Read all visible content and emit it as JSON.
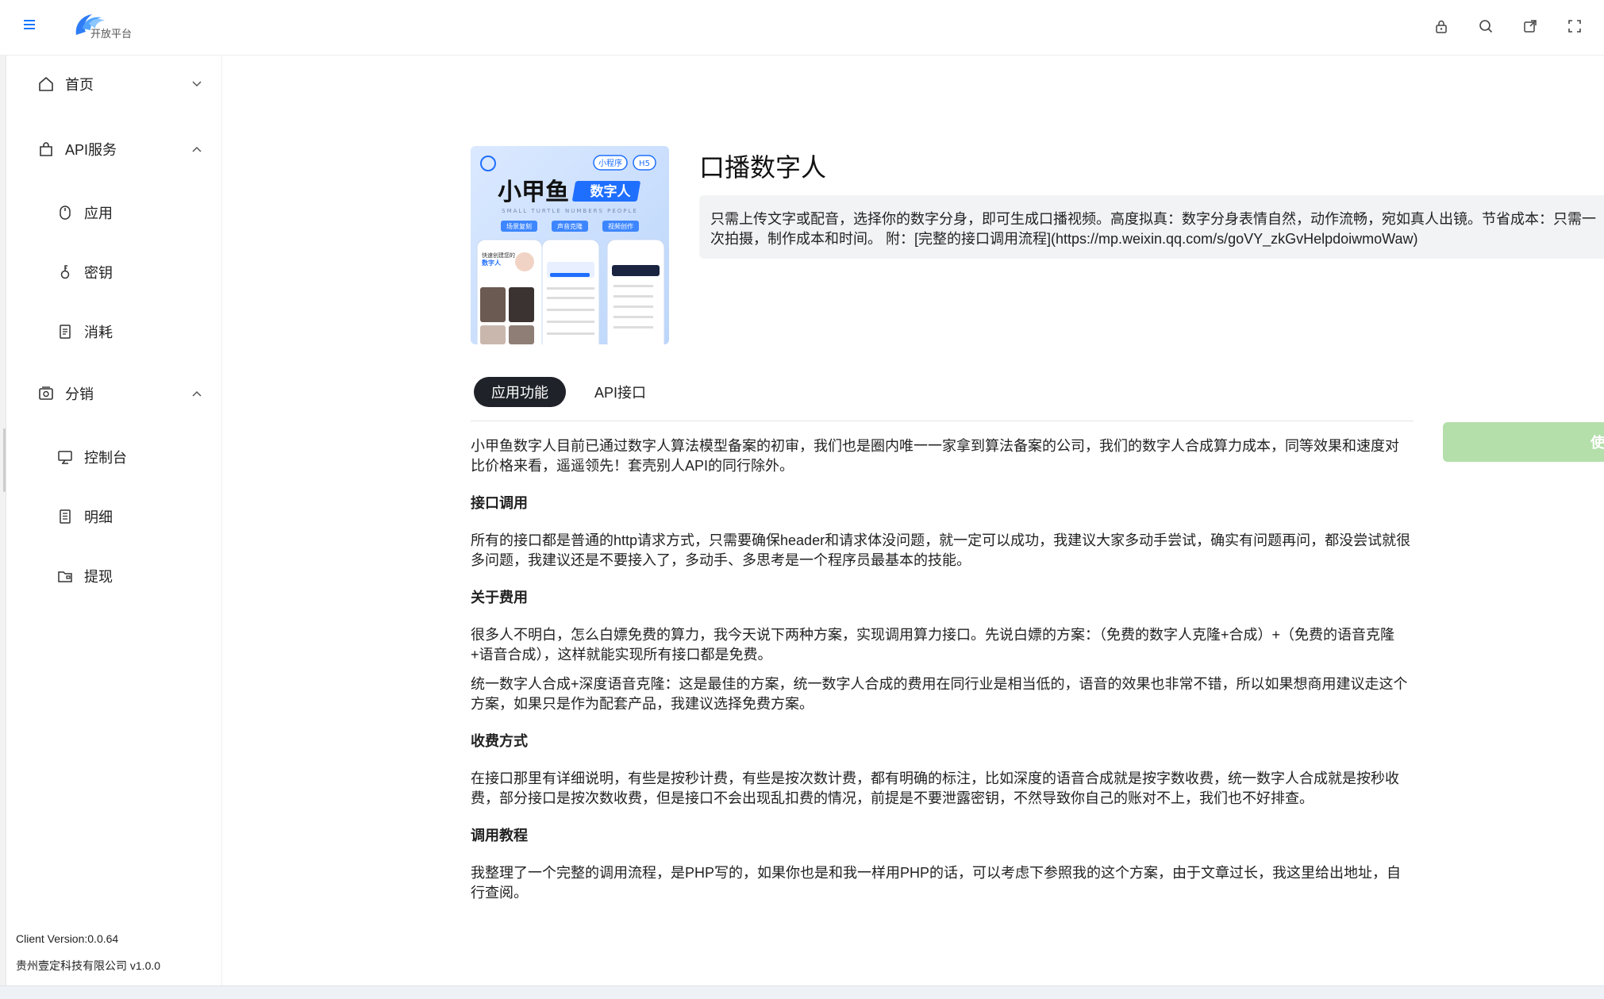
{
  "header": {
    "logo_text": "开放平台",
    "icons": [
      "lock-icon",
      "search-icon",
      "export-icon",
      "fullscreen-icon"
    ]
  },
  "sidebar": {
    "groups": [
      {
        "label": "首页",
        "icon": "home-icon",
        "expanded": false
      },
      {
        "label": "API服务",
        "icon": "bag-icon",
        "expanded": true,
        "items": [
          {
            "label": "应用",
            "icon": "mouse-icon"
          },
          {
            "label": "密钥",
            "icon": "key-icon"
          },
          {
            "label": "消耗",
            "icon": "document-icon"
          }
        ]
      },
      {
        "label": "分销",
        "icon": "distribution-icon",
        "expanded": true,
        "items": [
          {
            "label": "控制台",
            "icon": "monitor-icon"
          },
          {
            "label": "明细",
            "icon": "list-icon"
          },
          {
            "label": "提现",
            "icon": "wallet-icon"
          }
        ]
      }
    ],
    "client_version": "Client Version:0.0.64",
    "company": "贵州壹定科技有限公司 v1.0.0"
  },
  "app": {
    "title": "口播数字人",
    "description": "只需上传文字或配音，选择你的数字分身，即可生成口播视频。高度拟真：数字分身表情自然，动作流畅，宛如真人出镜。节省成本：只需一次拍摄，制作成本和时间。 附：[完整的接口调用流程](https://mp.weixin.qq.com/s/goVY_zkGvHelpdoiwmoWaw)",
    "cover": {
      "badge_1": "小程序",
      "badge_2": "H5",
      "brand": "小甲鱼",
      "brand_tag": "数字人",
      "subtitle": "SMALL TURTLE NUMBERS PEOPLE",
      "feature_1": "场景复刻",
      "feature_2": "声音克隆",
      "feature_3": "视频创作",
      "phone_text_1": "快速创建您的",
      "phone_text_2": "数字人",
      "accent_color": "#1f6fff"
    },
    "tabs": [
      "应用功能",
      "API接口"
    ],
    "use_button": "使用中"
  },
  "content": {
    "intro": "小甲鱼数字人目前已通过数字人算法模型备案的初审，我们也是圈内唯一一家拿到算法备案的公司，我们的数字人合成算力成本，同等效果和速度对比价格来看，遥遥领先！套壳别人API的同行除外。",
    "section_1_title": "接口调用",
    "section_1_text": "所有的接口都是普通的http请求方式，只需要确保header和请求体没问题，就一定可以成功，我建议大家多动手尝试，确实有问题再问，都没尝试就很多问题，我建议还是不要接入了，多动手、多思考是一个程序员最基本的技能。",
    "section_2_title": "关于费用",
    "section_2_text_1": "很多人不明白，怎么白嫖免费的算力，我今天说下两种方案，实现调用算力接口。先说白嫖的方案：（免费的数字人克隆+合成）+（免费的语音克隆+语音合成），这样就能实现所有接口都是免费。",
    "section_2_text_2": "统一数字人合成+深度语音克隆：这是最佳的方案，统一数字人合成的费用在同行业是相当低的，语音的效果也非常不错，所以如果想商用建议走这个方案，如果只是作为配套产品，我建议选择免费方案。",
    "section_3_title": "收费方式",
    "section_3_text": "在接口那里有详细说明，有些是按秒计费，有些是按次数计费，都有明确的标注，比如深度的语音合成就是按字数收费，统一数字人合成就是按秒收费，部分接口是按次数收费，但是接口不会出现乱扣费的情况，前提是不要泄露密钥，不然导致你自己的账对不上，我们也不好排查。",
    "section_4_title": "调用教程",
    "section_4_text": "我整理了一个完整的调用流程，是PHP写的，如果你也是和我一样用PHP的话，可以考虑下参照我的这个方案，由于文章过长，我这里给出地址，自行查阅。"
  }
}
